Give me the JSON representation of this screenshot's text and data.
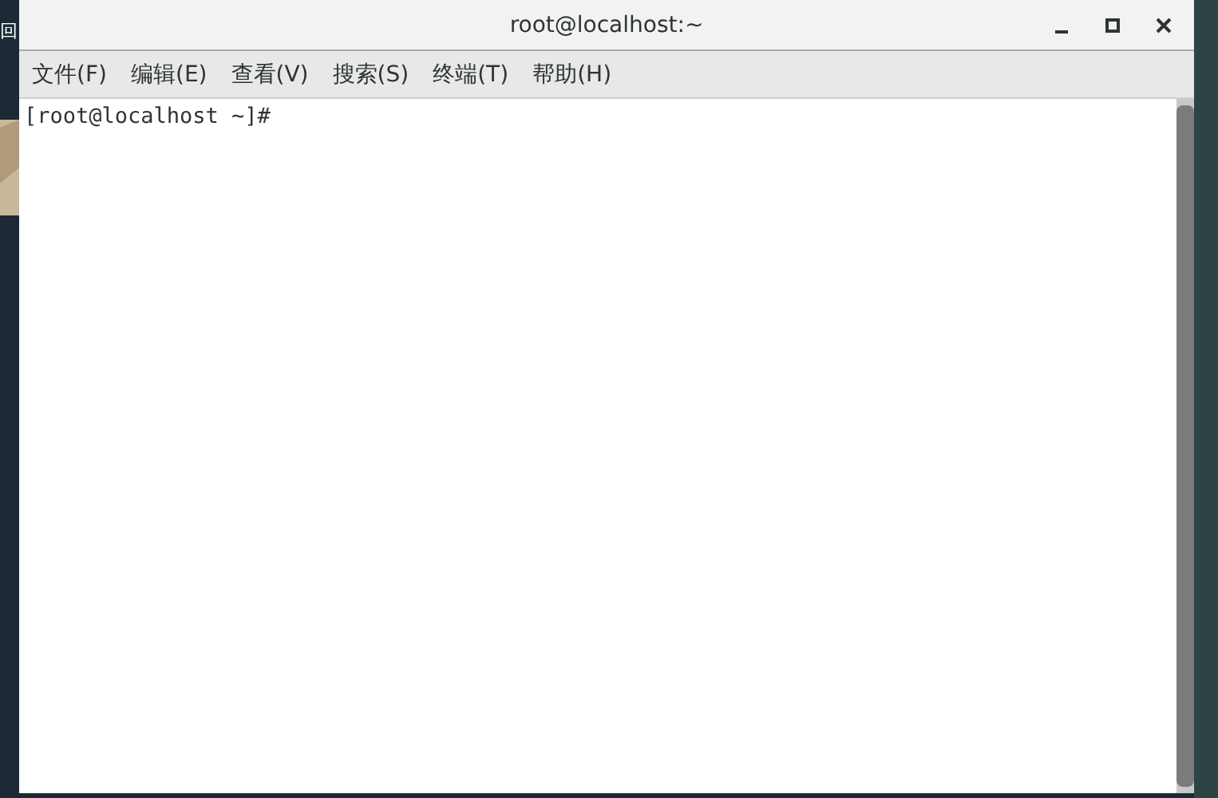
{
  "desktop": {
    "icon_label": "回"
  },
  "window": {
    "title": "root@localhost:~"
  },
  "menu": [
    "文件(F)",
    "编辑(E)",
    "查看(V)",
    "搜索(S)",
    "终端(T)",
    "帮助(H)"
  ],
  "terminal": {
    "lines": [
      "[root@localhost ~]#"
    ]
  }
}
